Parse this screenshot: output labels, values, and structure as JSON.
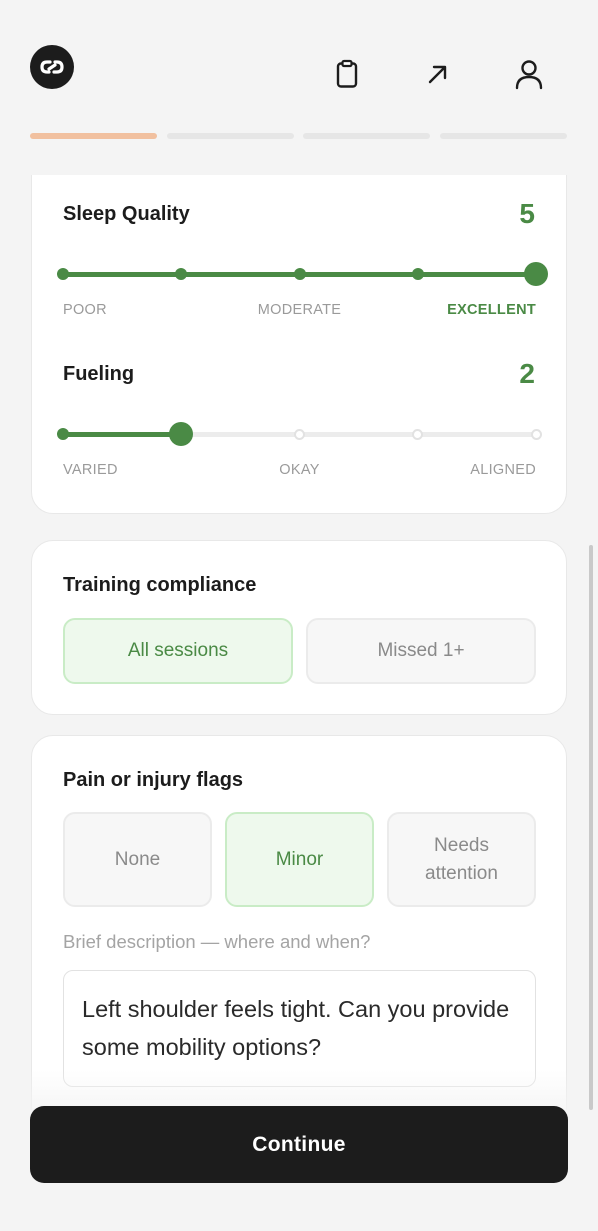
{
  "header": {
    "icons": [
      "logo-icon",
      "clipboard-icon",
      "arrow-up-right-icon",
      "profile-icon"
    ],
    "progress": {
      "total_steps": 4,
      "current_step": 1,
      "active_color": "#f1c09f"
    }
  },
  "sleep": {
    "title": "Sleep Quality",
    "value": "5",
    "scale": {
      "min": 1,
      "max": 5,
      "current": 5
    },
    "labels": {
      "low": "POOR",
      "mid": "MODERATE",
      "high": "EXCELLENT"
    }
  },
  "fueling": {
    "title": "Fueling",
    "value": "2",
    "scale": {
      "min": 1,
      "max": 5,
      "current": 2
    },
    "labels": {
      "low": "VARIED",
      "mid": "OKAY",
      "high": "ALIGNED"
    }
  },
  "training": {
    "title": "Training compliance",
    "options": [
      "All sessions",
      "Missed 1+"
    ],
    "selected": "All sessions"
  },
  "pain": {
    "title": "Pain or injury flags",
    "options": [
      "None",
      "Minor",
      "Needs attention"
    ],
    "selected": "Minor",
    "description_label": "Brief description — where and when?",
    "description_value": "Left shoulder feels tight. Can you provide some mobility options?"
  },
  "footer": {
    "continue_label": "Continue"
  },
  "colors": {
    "accent_green": "#4a8a45",
    "selected_bg": "#eef9ed",
    "button_dark": "#1c1c1c"
  }
}
